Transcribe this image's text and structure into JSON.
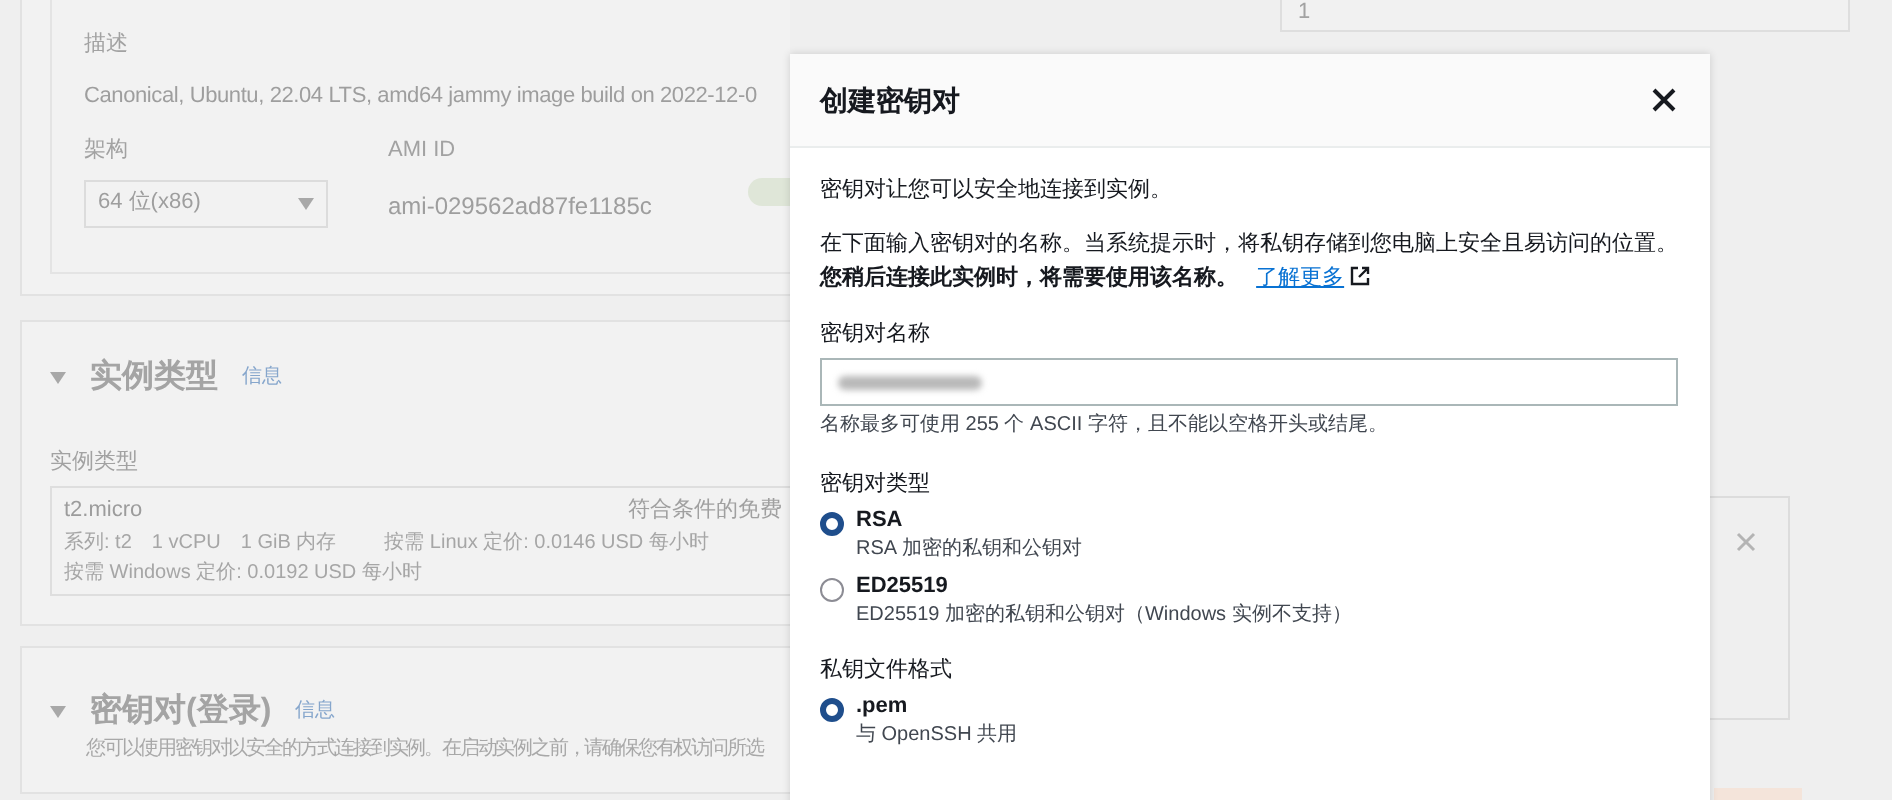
{
  "background": {
    "top_field_value": "1",
    "description_label": "描述",
    "description": "Canonical, Ubuntu, 22.04 LTS, amd64 jammy image build on 2022-12-0",
    "arch_label": "架构",
    "arch_value": "64 位(x86)",
    "ami_label": "AMI ID",
    "ami_id": "ami-029562ad87fe1185c",
    "instance_section": {
      "title": "实例类型",
      "info": "信息",
      "expanded": true
    },
    "instance_type_label": "实例类型",
    "instance_type": {
      "name": "t2.micro",
      "badge": "符合条件的免费",
      "line1": [
        "系列: t2",
        "1 vCPU",
        "1 GiB 内存",
        "按需 Linux 定价: 0.0146 USD 每小时"
      ],
      "line2": "按需 Windows 定价: 0.0192 USD 每小时"
    },
    "keypair_section": {
      "title": "密钥对(登录)",
      "info": "信息",
      "expanded": true
    },
    "keypair_description": "您可以使用密钥对以安全的方式连接到实例。在启动实例之前，请确保您有权访问所选"
  },
  "modal": {
    "title": "创建密钥对",
    "intro": "密钥对让您可以安全地连接到实例。",
    "instructions": "在下面输入密钥对的名称。当系统提示时，将私钥存储到您电脑上安全且易访问的位置。**您稍后连接此实例时，将需要使用该名称。**",
    "link": "了解更多",
    "name_label": "密钥对名称",
    "name_hint": "名称最多可使用 255 个 ASCII 字符，且不能以空格开头或结尾。",
    "key_type_label": "密钥对类型",
    "key_types": [
      {
        "label": "RSA",
        "description": "RSA 加密的私钥和公钥对",
        "selected": true
      },
      {
        "label": "ED25519",
        "description": "ED25519 加密的私钥和公钥对（Windows 实例不支持）",
        "selected": false
      }
    ],
    "format_label": "私钥文件格式",
    "formats": [
      {
        "label": ".pem",
        "description": "与 OpenSSH 共用",
        "selected": true
      }
    ]
  }
}
